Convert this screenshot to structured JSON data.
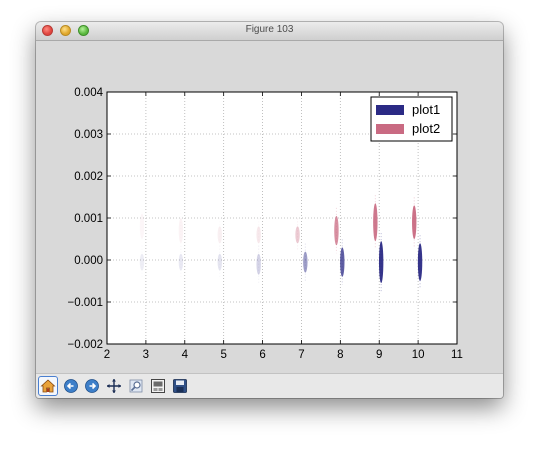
{
  "window": {
    "title": "Figure 103"
  },
  "toolbar": {
    "items": [
      {
        "name": "home-button",
        "icon": "home-icon"
      },
      {
        "name": "back-button",
        "icon": "back-arrow-icon"
      },
      {
        "name": "forward-button",
        "icon": "forward-arrow-icon"
      },
      {
        "name": "pan-button",
        "icon": "move-arrows-icon"
      },
      {
        "name": "zoom-button",
        "icon": "zoom-icon"
      },
      {
        "name": "configure-subplots-button",
        "icon": "subplots-icon"
      },
      {
        "name": "save-button",
        "icon": "floppy-disk-icon"
      }
    ]
  },
  "chart_data": {
    "type": "scatter",
    "title": "",
    "xlabel": "",
    "ylabel": "",
    "xlim": [
      2,
      11
    ],
    "ylim": [
      -0.002,
      0.004
    ],
    "grid": true,
    "legend_position": "top-right",
    "x_ticks": [
      "2",
      "3",
      "4",
      "5",
      "6",
      "7",
      "8",
      "9",
      "10",
      "11"
    ],
    "y_ticks": [
      "0.004",
      "0.003",
      "0.002",
      "0.001",
      "0.000",
      "−0.001",
      "−0.002"
    ],
    "series": [
      {
        "name": "plot1",
        "color": "#2b2a85",
        "points": [
          {
            "x": 2.9,
            "y": -5e-05,
            "spread": 0.0002,
            "alpha": 0.08
          },
          {
            "x": 3.9,
            "y": -5e-05,
            "spread": 0.0002,
            "alpha": 0.1
          },
          {
            "x": 4.9,
            "y": -5e-05,
            "spread": 0.0002,
            "alpha": 0.12
          },
          {
            "x": 5.9,
            "y": -0.0001,
            "spread": 0.00025,
            "alpha": 0.2
          },
          {
            "x": 7.1,
            "y": -5e-05,
            "spread": 0.00025,
            "alpha": 0.45
          },
          {
            "x": 8.05,
            "y": -5e-05,
            "spread": 0.00035,
            "alpha": 0.75
          },
          {
            "x": 9.05,
            "y": -5e-05,
            "spread": 0.0005,
            "alpha": 0.95
          },
          {
            "x": 10.05,
            "y": -5e-05,
            "spread": 0.00045,
            "alpha": 0.95
          }
        ]
      },
      {
        "name": "plot2",
        "color": "#c96a82",
        "points": [
          {
            "x": 2.9,
            "y": 0.0008,
            "spread": 0.0003,
            "alpha": 0.06
          },
          {
            "x": 3.9,
            "y": 0.0007,
            "spread": 0.0003,
            "alpha": 0.08
          },
          {
            "x": 4.9,
            "y": 0.0006,
            "spread": 0.0002,
            "alpha": 0.1
          },
          {
            "x": 5.9,
            "y": 0.0006,
            "spread": 0.0002,
            "alpha": 0.15
          },
          {
            "x": 6.9,
            "y": 0.0006,
            "spread": 0.0002,
            "alpha": 0.35
          },
          {
            "x": 7.9,
            "y": 0.0007,
            "spread": 0.00035,
            "alpha": 0.75
          },
          {
            "x": 8.9,
            "y": 0.0009,
            "spread": 0.00045,
            "alpha": 0.9
          },
          {
            "x": 9.9,
            "y": 0.0009,
            "spread": 0.0004,
            "alpha": 0.95
          }
        ]
      }
    ]
  }
}
